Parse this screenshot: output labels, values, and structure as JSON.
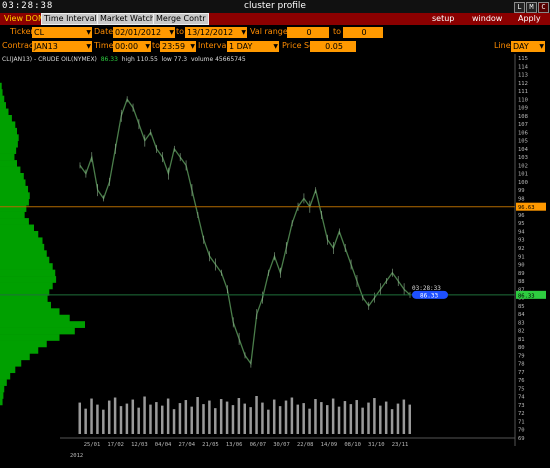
{
  "window": {
    "clock": "03:28:38",
    "title": "cluster profile",
    "buttons": [
      "L",
      "M",
      "C"
    ]
  },
  "menubar": {
    "left_items": [
      "View DOM",
      "Time Interval",
      "Market Watch",
      "Merge Contr"
    ],
    "right_items": [
      "setup",
      "window",
      "Apply"
    ]
  },
  "toolbar": {
    "ticker_label": "Ticker",
    "ticker": "CL",
    "date_label": "Date",
    "date_from": "02/01/2012",
    "to_label": "to",
    "date_to": "13/12/2012",
    "val_range_label": "Val range",
    "val_from": "0",
    "val_to_label": "to",
    "val_to": "0",
    "contract_label": "Contract",
    "contract": "JAN13",
    "time_label": "Time",
    "time_from": "00:00",
    "time_to_label": "to",
    "time_to": "23:59",
    "interval_label": "Interval",
    "interval": "1 DAY",
    "price_scale_label": "Price Scale",
    "price_scale": "0.05",
    "line_label": "Line",
    "line": "DAY"
  },
  "chart_header": {
    "symbol": "CL(JAN13) - CRUDE OIL(NYMEX)",
    "last": "86.33",
    "high_label": "high",
    "high": "110.55",
    "low_label": "low",
    "low": "77.3",
    "volume_label": "volume",
    "volume": "45665745"
  },
  "colors": {
    "menubar": "#8b0000",
    "field": "#ff9900",
    "label": "#ff8c00",
    "profile": "#00a000",
    "price_line": "#2ecc40",
    "current_badge": "#1e50ff"
  },
  "chart_data": {
    "type": "line",
    "y_ticks": [
      "115",
      "114",
      "113",
      "112",
      "111",
      "110",
      "109",
      "108",
      "107",
      "106",
      "105",
      "104",
      "103",
      "102",
      "101",
      "100",
      "99",
      "98",
      "97",
      "96",
      "95",
      "94",
      "93",
      "92",
      "91",
      "90",
      "89",
      "88",
      "87",
      "86",
      "85",
      "84",
      "83",
      "82",
      "81",
      "80",
      "79",
      "78",
      "77",
      "76",
      "75",
      "74",
      "73",
      "72",
      "71",
      "70",
      "69"
    ],
    "ylim": [
      69,
      115
    ],
    "x_labels": [
      "25/01",
      "17/02",
      "12/03",
      "04/04",
      "27/04",
      "21/05",
      "13/06",
      "06/07",
      "30/07",
      "22/08",
      "14/09",
      "08/10",
      "31/10",
      "23/11"
    ],
    "year_label": "2012",
    "closes": [
      102,
      101,
      103,
      99,
      98,
      100,
      104,
      108,
      110,
      109,
      107,
      105,
      106,
      104,
      103,
      101,
      104,
      103,
      102,
      99,
      96,
      93,
      91,
      90,
      89,
      87,
      83,
      81,
      79,
      78,
      84,
      86,
      89,
      91,
      89,
      92,
      95,
      97,
      98,
      97,
      99,
      96,
      93,
      92,
      94,
      92,
      90,
      88,
      86,
      85,
      86,
      87,
      88,
      89,
      88,
      87,
      86.33
    ],
    "volume": [
      62,
      50,
      70,
      58,
      48,
      66,
      72,
      55,
      60,
      68,
      52,
      74,
      58,
      63,
      56,
      70,
      49,
      61,
      67,
      54,
      73,
      59,
      66,
      51,
      69,
      64,
      57,
      71,
      60,
      53,
      75,
      62,
      48,
      68,
      55,
      66,
      72,
      58,
      61,
      50,
      69,
      63,
      57,
      70,
      54,
      65,
      59,
      67,
      52,
      62,
      71,
      56,
      64,
      49,
      60,
      68,
      58
    ],
    "profile": [
      0.02,
      0.03,
      0.05,
      0.07,
      0.1,
      0.14,
      0.18,
      0.2,
      0.22,
      0.21,
      0.19,
      0.17,
      0.2,
      0.24,
      0.28,
      0.3,
      0.33,
      0.35,
      0.34,
      0.31,
      0.29,
      0.34,
      0.4,
      0.45,
      0.5,
      0.52,
      0.55,
      0.58,
      0.62,
      0.65,
      0.66,
      0.62,
      0.58,
      0.56,
      0.6,
      0.7,
      0.82,
      1.0,
      0.88,
      0.7,
      0.55,
      0.45,
      0.35,
      0.25,
      0.18,
      0.12,
      0.08,
      0.05,
      0.04,
      0.03
    ],
    "horizontal_line_value": 97.0,
    "horizontal_line_label": "96.63",
    "current_price": "86.33",
    "current_time": "03:28:33"
  }
}
